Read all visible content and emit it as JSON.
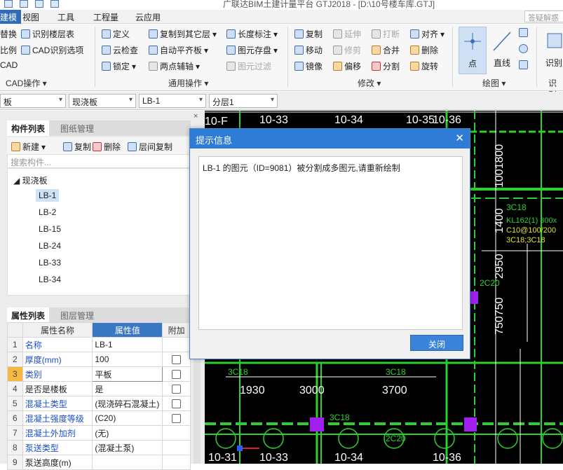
{
  "window": {
    "title": "广联达BIM土建计量平台 GTJ2018 - [D:\\10号楼车库.GTJ]"
  },
  "menu": {
    "tabs": [
      "建模",
      "视图",
      "工具",
      "工程量",
      "云应用"
    ],
    "search_placeholder": "答疑解惑"
  },
  "ribbon": {
    "cad": {
      "items": [
        "替换",
        "识别楼层表",
        "比例",
        "CAD识别选项",
        "CAD"
      ],
      "label": "CAD操作"
    },
    "general": {
      "items": [
        "定义",
        "复制到其它层",
        "长度标注",
        "云检查",
        "自动平齐板",
        "图元存盘",
        "锁定",
        "两点辅轴",
        "图元过滤"
      ],
      "label": "通用操作"
    },
    "modify": {
      "items": [
        "复制",
        "延伸",
        "打断",
        "对齐",
        "移动",
        "修剪",
        "合并",
        "删除",
        "镜像",
        "偏移",
        "分割",
        "旋转"
      ],
      "label": "修改"
    },
    "draw": {
      "items": [
        "点",
        "直线"
      ],
      "label": "绘图"
    },
    "identify": {
      "items": [
        "识别"
      ],
      "label": "识别"
    }
  },
  "toolbar2": {
    "combos": [
      "板",
      "现浇板",
      "LB-1",
      "分层1"
    ]
  },
  "component_panel": {
    "tabs": [
      "构件列表",
      "图纸管理"
    ],
    "tools": [
      "新建",
      "复制",
      "删除",
      "层间复制"
    ],
    "search_placeholder": "搜索构件...",
    "tree_root": "现浇板",
    "items": [
      "LB-1",
      "LB-2",
      "LB-15",
      "LB-24",
      "LB-33",
      "LB-34"
    ],
    "selected": "LB-1"
  },
  "property_panel": {
    "tabs": [
      "属性列表",
      "图层管理"
    ],
    "headers": [
      "属性名称",
      "属性值",
      "附加"
    ],
    "rows": [
      {
        "no": "1",
        "name": "名称",
        "value": "LB-1",
        "checkbox": false
      },
      {
        "no": "2",
        "name": "厚度(mm)",
        "value": "100",
        "checkbox": true
      },
      {
        "no": "3",
        "name": "类别",
        "value": "平板",
        "checkbox": true
      },
      {
        "no": "4",
        "name": "是否是楼板",
        "value": "是",
        "checkbox": true
      },
      {
        "no": "5",
        "name": "混凝土类型",
        "value": "(现浇碎石混凝土)",
        "checkbox": true
      },
      {
        "no": "6",
        "name": "混凝土强度等级",
        "value": "(C20)",
        "checkbox": true
      },
      {
        "no": "7",
        "name": "混凝土外加剂",
        "value": "(无)",
        "checkbox": false
      },
      {
        "no": "8",
        "name": "泵送类型",
        "value": "(混凝土泵)",
        "checkbox": false
      },
      {
        "no": "9",
        "name": "泵送高度(m)",
        "value": "",
        "checkbox": false
      }
    ]
  },
  "canvas_labels": {
    "axis_top": [
      "10-F",
      "10-33",
      "10-34",
      "10-35",
      "10-36"
    ],
    "axis_bottom": [
      "10-31",
      "10-33",
      "10-34",
      "10-36"
    ],
    "dims": [
      "1930",
      "3000",
      "3700"
    ],
    "vertical_dims": [
      "1001800",
      "1400",
      "2950",
      "750750"
    ],
    "rebar": [
      "3C18",
      "3C18",
      "3C18",
      "2C20",
      "2C20",
      "3C18",
      "KL162(1) 300x",
      "C10@100/200",
      "3C18;3C18"
    ]
  },
  "dialog": {
    "title": "提示信息",
    "message": "LB-1 的图元（ID=9081）被分割成多图元,请重新绘制",
    "close_button": "关闭"
  }
}
